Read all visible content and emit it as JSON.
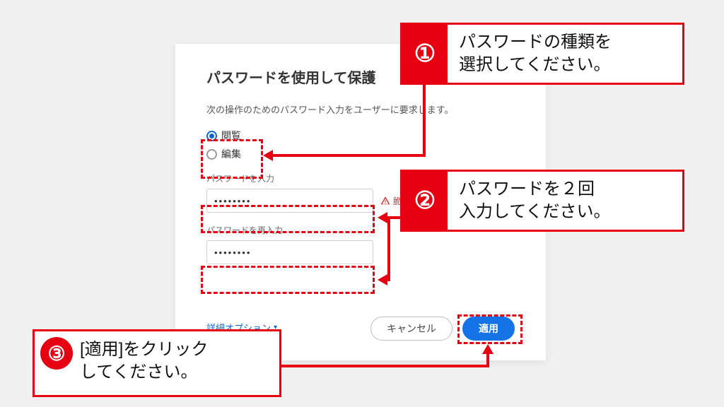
{
  "dialog": {
    "title": "パスワードを使用して保護",
    "subtitle": "次の操作のためのパスワード入力をユーザーに要求します。",
    "radios": {
      "view": "閲覧",
      "edit": "編集"
    },
    "pw_label": "パスワードを入力",
    "pw_value": "••••••••",
    "pw_warning": "脆弱なパスワード",
    "pw2_label": "パスワードを再入力",
    "pw2_value": "••••••••",
    "advanced": "詳細オプション",
    "buttons": {
      "cancel": "キャンセル",
      "apply": "適用"
    }
  },
  "callouts": {
    "c1": {
      "num": "①",
      "text": "パスワードの種類を\n選択してください。"
    },
    "c2": {
      "num": "②",
      "text": "パスワードを２回\n入力してください。"
    },
    "c3": {
      "num": "③",
      "text": "[適用]をクリック\nしてください。"
    }
  },
  "colors": {
    "accent_red": "#e60012",
    "primary_blue": "#1473e6"
  }
}
